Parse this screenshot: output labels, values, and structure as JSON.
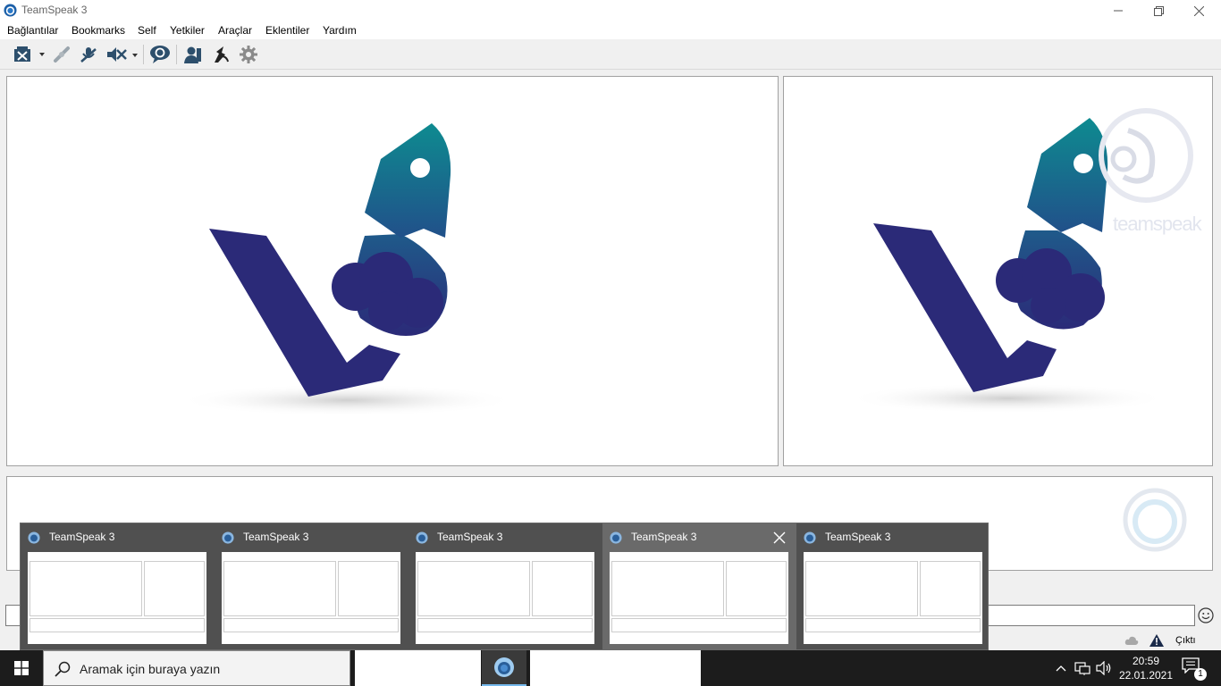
{
  "window": {
    "title": "TeamSpeak 3"
  },
  "menu": {
    "items": [
      "Bağlantılar",
      "Bookmarks",
      "Self",
      "Yetkiler",
      "Araçlar",
      "Eklentiler",
      "Yardım"
    ]
  },
  "toolbar": {
    "icons": [
      "connect-icon",
      "disconnect-icon",
      "mute-microphone-icon",
      "mute-speakers-icon",
      "away-icon",
      "contacts-icon",
      "whisper-icon",
      "settings-icon"
    ]
  },
  "panels": {
    "right_watermark": "teamspeak"
  },
  "statusbar": {
    "status_text": "Çıktı"
  },
  "taskbar_preview": {
    "thumbnails": [
      {
        "title": "TeamSpeak 3"
      },
      {
        "title": "TeamSpeak 3"
      },
      {
        "title": "TeamSpeak 3"
      },
      {
        "title": "TeamSpeak 3"
      },
      {
        "title": "TeamSpeak 3"
      }
    ]
  },
  "taskbar": {
    "search_placeholder": "Aramak için buraya yazın",
    "time": "20:59",
    "date": "22.01.2021",
    "notification_count": "1"
  },
  "colors": {
    "logo_navy": "#2b2a78",
    "logo_teal": "#127b8c",
    "taskbar_bg": "#1c1c1c",
    "preview_bg": "#505050",
    "accent": "#76b9ed"
  }
}
